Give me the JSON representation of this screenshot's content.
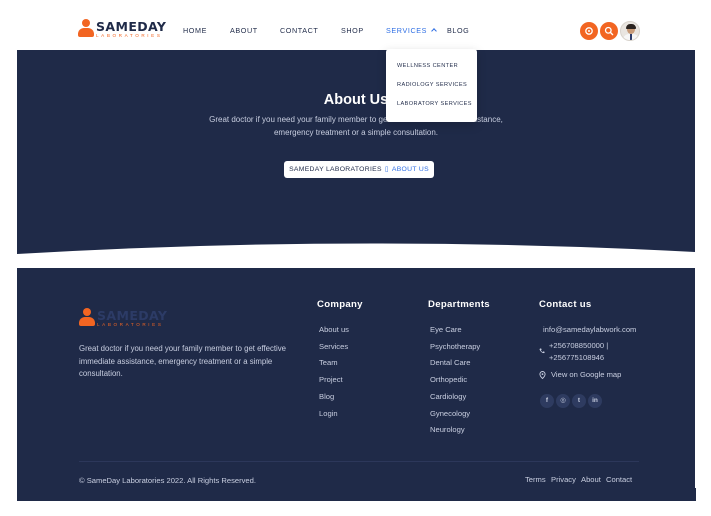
{
  "brand": {
    "name": "SAMEDAY",
    "tagline": "LABORATORIES",
    "colors": {
      "navy": "#1f2a48",
      "orange": "#f26522",
      "link_blue": "#2f6fe4"
    }
  },
  "nav": {
    "items": [
      {
        "label": "HOME"
      },
      {
        "label": "ABOUT"
      },
      {
        "label": "CONTACT"
      },
      {
        "label": "SHOP"
      },
      {
        "label": "SERVICES",
        "active": true
      },
      {
        "label": "BLOG"
      }
    ]
  },
  "header_icons": [
    "settings-icon",
    "search-icon",
    "avatar"
  ],
  "services_dropdown": {
    "items": [
      {
        "label": "WELLNESS CENTER"
      },
      {
        "label": "RADIOLOGY SERVICES"
      },
      {
        "label": "LABORATORY SERVICES"
      }
    ]
  },
  "hero": {
    "title": "About Us",
    "text": "Great doctor if you need your family member to get effective immediate assistance, emergency treatment or a simple consultation.",
    "breadcrumb": {
      "root": "SAMEDAY LABORATORIES",
      "separator": "▯",
      "current": "ABOUT US"
    }
  },
  "footer": {
    "description": "Great doctor if you need your family member to get effective immediate assistance, emergency treatment or a simple consultation.",
    "company": {
      "title": "Company",
      "links": [
        "About us",
        "Services",
        "Team",
        "Project",
        "Blog",
        "Login"
      ]
    },
    "departments": {
      "title": "Departments",
      "links": [
        "Eye Care",
        "Psychotherapy",
        "Dental Care",
        "Orthopedic",
        "Cardiology",
        "Gynecology",
        "Neurology"
      ]
    },
    "contact": {
      "title": "Contact us",
      "email": "info@samedaylabwork.com",
      "phone_line1": "+256708850000 |",
      "phone_line2": "+256775108946",
      "map_link": "View on Google map",
      "social": [
        {
          "icon": "facebook-icon",
          "glyph": "f"
        },
        {
          "icon": "instagram-icon",
          "glyph": "◎"
        },
        {
          "icon": "twitter-icon",
          "glyph": "t"
        },
        {
          "icon": "linkedin-icon",
          "glyph": "in"
        }
      ]
    },
    "copyright": "© SameDay Laboratories 2022. All Rights Reserved.",
    "bottom_links": [
      "Terms",
      "Privacy",
      "About",
      "Contact"
    ]
  }
}
